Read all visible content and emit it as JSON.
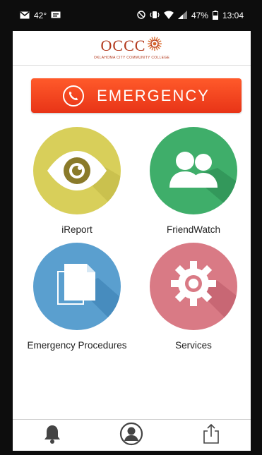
{
  "status_bar": {
    "temperature": "42°",
    "battery": "47%",
    "time": "13:04",
    "icons": [
      "gmail-icon",
      "message-icon",
      "mute-icon",
      "vibrate-icon",
      "wifi-icon",
      "signal-icon",
      "battery-icon"
    ]
  },
  "header": {
    "logo_text": "OCCC",
    "logo_subtitle": "OKLAHOMA CITY COMMUNITY COLLEGE",
    "brand_color": "#b33a1e"
  },
  "emergency": {
    "label": "EMERGENCY",
    "icon": "phone-icon",
    "color": "#f0431e"
  },
  "tiles": [
    {
      "label": "iReport",
      "icon": "eye-icon",
      "color": "#d8cf5a"
    },
    {
      "label": "FriendWatch",
      "icon": "people-icon",
      "color": "#3fae6a"
    },
    {
      "label": "Emergency Procedures",
      "icon": "documents-icon",
      "color": "#5a9fcf"
    },
    {
      "label": "Services",
      "icon": "gear-icon",
      "color": "#d97a85"
    }
  ],
  "bottom_nav": {
    "items": [
      {
        "icon": "bell-icon"
      },
      {
        "icon": "profile-icon"
      },
      {
        "icon": "share-icon"
      }
    ]
  }
}
